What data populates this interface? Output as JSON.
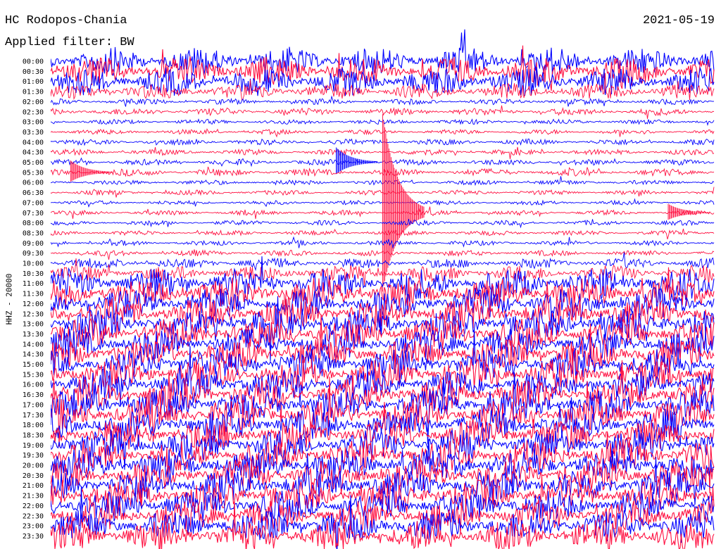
{
  "header": {
    "title": "HC Rodopos-Chania",
    "date": "2021-05-19",
    "filter_label": "Applied filter: BW"
  },
  "channel_label": "HHZ - 20000",
  "colors": {
    "line_a": "#0000ff",
    "line_b": "#ff0f40"
  },
  "chart_data": {
    "type": "line",
    "title": "HC Rodopos-Chania",
    "date": "2021-05-19",
    "ylabel": "HHZ - 20000",
    "y_tick_labels": [
      "00:00",
      "00:30",
      "01:00",
      "01:30",
      "02:00",
      "02:30",
      "03:00",
      "03:30",
      "04:00",
      "04:30",
      "05:00",
      "05:30",
      "06:00",
      "06:30",
      "07:00",
      "07:30",
      "08:00",
      "08:30",
      "09:00",
      "09:30",
      "10:00",
      "10:30",
      "11:00",
      "11:30",
      "12:00",
      "12:30",
      "13:00",
      "13:30",
      "14:00",
      "14:30",
      "15:00",
      "15:30",
      "16:00",
      "16:30",
      "17:00",
      "17:30",
      "18:00",
      "18:30",
      "19:00",
      "19:30",
      "20:00",
      "20:30",
      "21:00",
      "21:30",
      "22:00",
      "22:30",
      "23:00",
      "23:30"
    ],
    "series_colors": [
      "#0000ff",
      "#ff0f40"
    ],
    "trace_noise_level": [
      0.9,
      0.95,
      0.9,
      0.5,
      0.15,
      0.2,
      0.12,
      0.12,
      0.15,
      0.15,
      0.15,
      0.2,
      0.12,
      0.12,
      0.1,
      0.12,
      0.12,
      0.12,
      0.12,
      0.15,
      0.3,
      0.5,
      1,
      1,
      1,
      1,
      1,
      1,
      1,
      1,
      1,
      1,
      1,
      1,
      1,
      1,
      1,
      1,
      1,
      1,
      1,
      1,
      1,
      1,
      1,
      1,
      1,
      1
    ],
    "events": [
      {
        "trace": "07:30",
        "time_fraction": 0.5,
        "amplitude": 10
      },
      {
        "trace": "05:30",
        "time_fraction": 0.03,
        "amplitude": 1.2
      },
      {
        "trace": "05:00",
        "time_fraction": 0.43,
        "amplitude": 1.5
      },
      {
        "trace": "07:30",
        "time_fraction": 0.93,
        "amplitude": 0.9
      }
    ],
    "grid": false
  }
}
